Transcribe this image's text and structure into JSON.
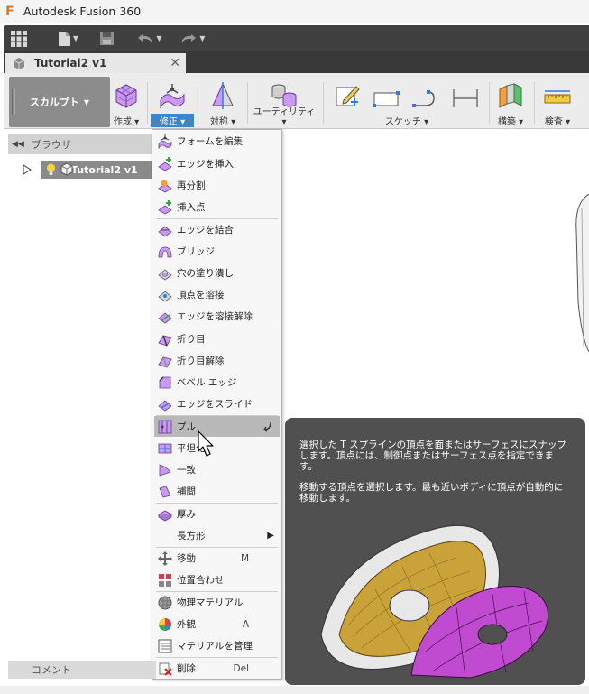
{
  "app": {
    "title": "Autodesk Fusion 360"
  },
  "document_tab": {
    "label": "Tutorial2 v1"
  },
  "ribbon": {
    "workspace": "スカルプト",
    "groups": [
      "作成",
      "修正",
      "対称",
      "ユーティリティ",
      "スケッチ",
      "構築",
      "検査"
    ]
  },
  "browser": {
    "title": "ブラウザ",
    "root_node": "Tutorial2 v1"
  },
  "comment_bar": {
    "label": "コメント"
  },
  "menu": {
    "items": [
      {
        "label": "フォームを編集"
      },
      {
        "label": "エッジを挿入"
      },
      {
        "label": "再分割"
      },
      {
        "label": "挿入点"
      },
      {
        "label": "エッジを結合"
      },
      {
        "label": "ブリッジ"
      },
      {
        "label": "穴の塗り潰し"
      },
      {
        "label": "頂点を溶接"
      },
      {
        "label": "エッジを溶接解除"
      },
      {
        "label": "折り目"
      },
      {
        "label": "折り目解除"
      },
      {
        "label": "ベベル エッジ"
      },
      {
        "label": "エッジをスライド"
      },
      {
        "label": "プル"
      },
      {
        "label": "平坦化"
      },
      {
        "label": "一致"
      },
      {
        "label": "補間"
      },
      {
        "label": "厚み"
      },
      {
        "label": "長方形"
      },
      {
        "label": "移動",
        "shortcut": "M"
      },
      {
        "label": "位置合わせ"
      },
      {
        "label": "物理マテリアル"
      },
      {
        "label": "外観",
        "shortcut": "A"
      },
      {
        "label": "マテリアルを管理"
      },
      {
        "label": "削除",
        "shortcut": "Del"
      }
    ]
  },
  "tooltip": {
    "paragraph1": "選択した T スプラインの頂点を面またはサーフェスにスナップします。頂点には、制御点またはサーフェス点を指定できます。",
    "paragraph2": "移動する頂点を選択します。最も近いボディに頂点が自動的に移動します。"
  }
}
